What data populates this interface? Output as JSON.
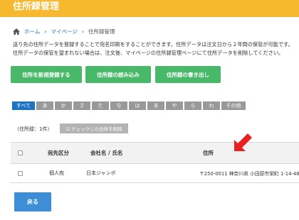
{
  "header": {
    "title": "住所録管理"
  },
  "breadcrumb": {
    "home": "ホーム",
    "separator": "›",
    "mypage": "マイページ",
    "current": "住所録管理"
  },
  "intro": {
    "line1": "送り先の住所データを登録することで宛名印刷をすることができます。住所データは注文日から２年間の保管が可能です。",
    "line2": "住所データの保管を望まれない場合は、注文後、マイページの住所録管理ページにて住所データを削除してください。"
  },
  "actions": {
    "new": "住所を新規登録する",
    "import": "住所録の読み込み",
    "export": "住所録の書き出し"
  },
  "kana_tabs": [
    "すべて",
    "あ",
    "か",
    "さ",
    "た",
    "な",
    "は",
    "ま",
    "や",
    "ら",
    "わ",
    "その他"
  ],
  "list": {
    "count_label": "（住所録：1件）",
    "delete_checked": "☑ チェックした住所を削除"
  },
  "table": {
    "headers": {
      "type": "宛先区分",
      "name": "会社名 / 氏名",
      "address": "住所"
    },
    "rows": [
      {
        "type": "個人宛",
        "name": "日本ジャンボ",
        "address": "〒250-0011 神奈川県 小田原市栄町 1-14-48"
      }
    ]
  },
  "back": "戻る",
  "colors": {
    "header": "#f5b82e",
    "green": "#48b968",
    "blue": "#1a73c6",
    "arrow": "#e8201f",
    "back": "#3d8ed6"
  },
  "icons": {
    "home": "home-icon",
    "arrow": "red-arrow-icon"
  }
}
